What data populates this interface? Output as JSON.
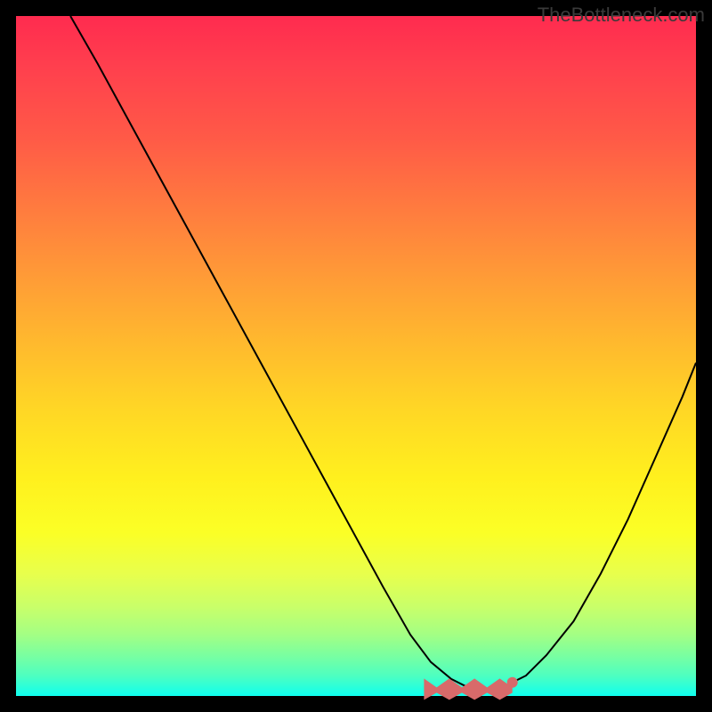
{
  "watermark": "TheBottleneck.com",
  "chart_data": {
    "type": "line",
    "title": "",
    "xlabel": "",
    "ylabel": "",
    "xlim": [
      0,
      100
    ],
    "ylim": [
      0,
      100
    ],
    "series": [
      {
        "name": "curve",
        "x": [
          8,
          12,
          18,
          24,
          30,
          36,
          42,
          48,
          54,
          58,
          61,
          64,
          66,
          68,
          70,
          72,
          75,
          78,
          82,
          86,
          90,
          94,
          98,
          100
        ],
        "y": [
          100,
          93,
          82,
          71,
          60,
          49,
          38,
          27,
          16,
          9,
          5,
          2.5,
          1.5,
          1,
          1,
          1.5,
          3,
          6,
          11,
          18,
          26,
          35,
          44,
          49
        ]
      }
    ],
    "highlight_region": {
      "x_start": 60,
      "x_end": 73,
      "y": 1
    },
    "highlight_dot": {
      "x": 73,
      "y": 2
    },
    "background_gradient": {
      "top": "#ff2b4f",
      "mid": "#fff01e",
      "bottom": "#0ffff0"
    }
  }
}
